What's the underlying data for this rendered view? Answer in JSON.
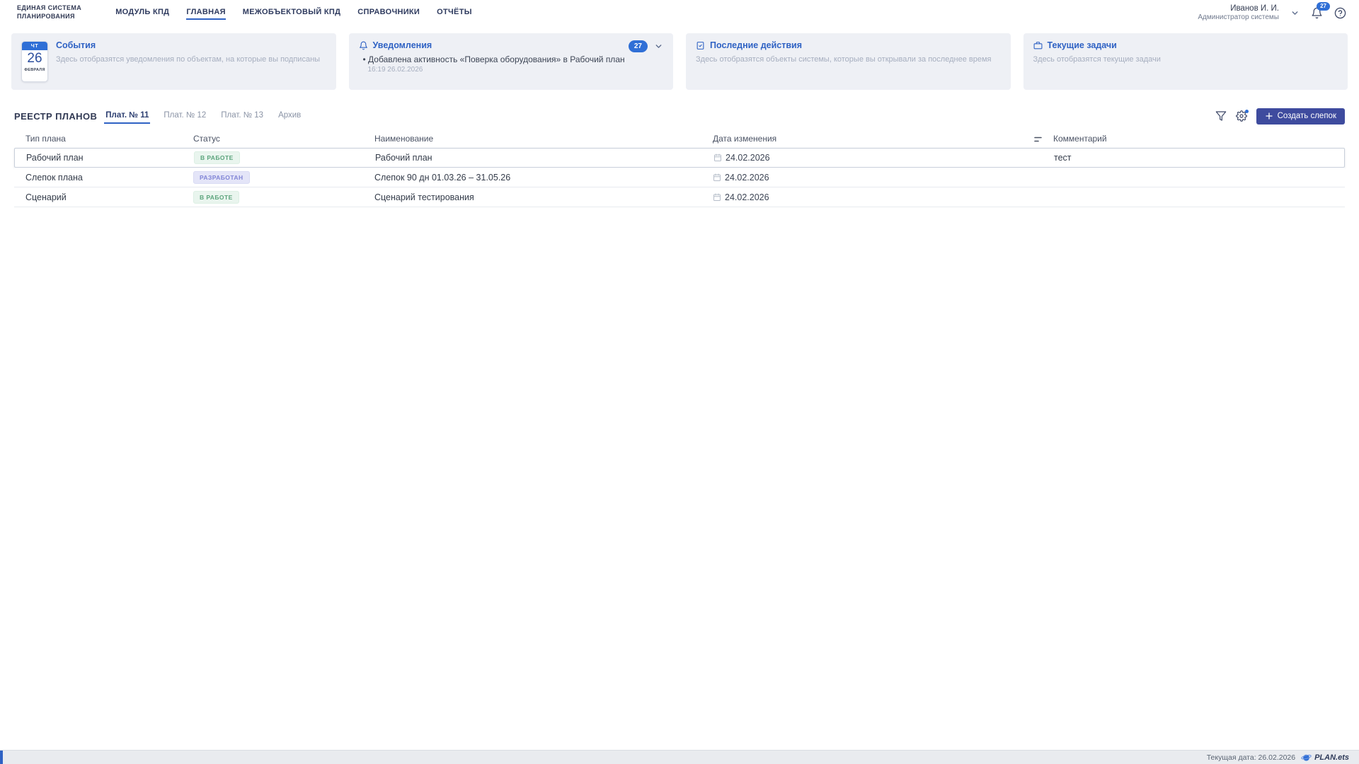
{
  "header": {
    "logo_line1": "ЕДИНАЯ СИСТЕМА",
    "logo_line2": "ПЛАНИРОВАНИЯ",
    "nav": [
      {
        "label": "МОДУЛЬ КПД"
      },
      {
        "label": "ГЛАВНАЯ"
      },
      {
        "label": "МЕЖОБЪЕКТОВЫЙ КПД"
      },
      {
        "label": "СПРАВОЧНИКИ"
      },
      {
        "label": "ОТЧЁТЫ"
      }
    ],
    "user_name": "Иванов И. И.",
    "user_role": "Администратор системы",
    "notifications_count": "27"
  },
  "cards": {
    "events": {
      "title": "События",
      "subtitle": "Здесь отобразятся уведомления по объектам, на которые вы подписаны",
      "calendar": {
        "weekday": "ЧТ",
        "day": "26",
        "month": "ФЕВРАЛЯ"
      }
    },
    "notifications": {
      "title": "Уведомления",
      "item_text": "Добавлена активность «Поверка оборудования» в Рабочий план",
      "item_time": "16:19 26.02.2026",
      "badge": "27"
    },
    "recent": {
      "title": "Последние действия",
      "subtitle": "Здесь отобразятся объекты системы, которые вы открывали за последнее время"
    },
    "tasks": {
      "title": "Текущие задачи",
      "subtitle": "Здесь отобразятся текущие задачи"
    }
  },
  "registry": {
    "title": "РЕЕСТР ПЛАНОВ",
    "tabs": [
      {
        "label": "Плат. № 11"
      },
      {
        "label": "Плат. № 12"
      },
      {
        "label": "Плат. № 13"
      },
      {
        "label": "Архив"
      }
    ],
    "create_button": "Создать слепок",
    "columns": {
      "type": "Тип плана",
      "status": "Статус",
      "name": "Наименование",
      "date": "Дата изменения",
      "comment": "Комментарий"
    },
    "rows": [
      {
        "type": "Рабочий план",
        "status": "В РАБОТЕ",
        "name": "Рабочий план",
        "date": "24.02.2026",
        "comment": "тест"
      },
      {
        "type": "Слепок плана",
        "status": "РАЗРАБОТАН",
        "name": "Слепок 90 дн 01.03.26 – 31.05.26",
        "date": "24.02.2026",
        "comment": ""
      },
      {
        "type": "Сценарий",
        "status": "В РАБОТЕ",
        "name": "Сценарий тестирования",
        "date": "24.02.2026",
        "comment": ""
      }
    ]
  },
  "footer": {
    "current_date_label": "Текущая дата: 26.02.2026",
    "logo_text": "PLAN.ets"
  },
  "colors": {
    "accent_blue": "#2f62c4",
    "badge_blue": "#2f6fd6",
    "button_indigo": "#3e4b9e",
    "status_green": "#5ba47c",
    "status_green_bg": "#e9f5ee",
    "status_purple": "#8084d6",
    "status_purple_bg": "#e4e5f8",
    "card_bg": "#eef0f5",
    "footer_bg": "#e9ebef"
  }
}
